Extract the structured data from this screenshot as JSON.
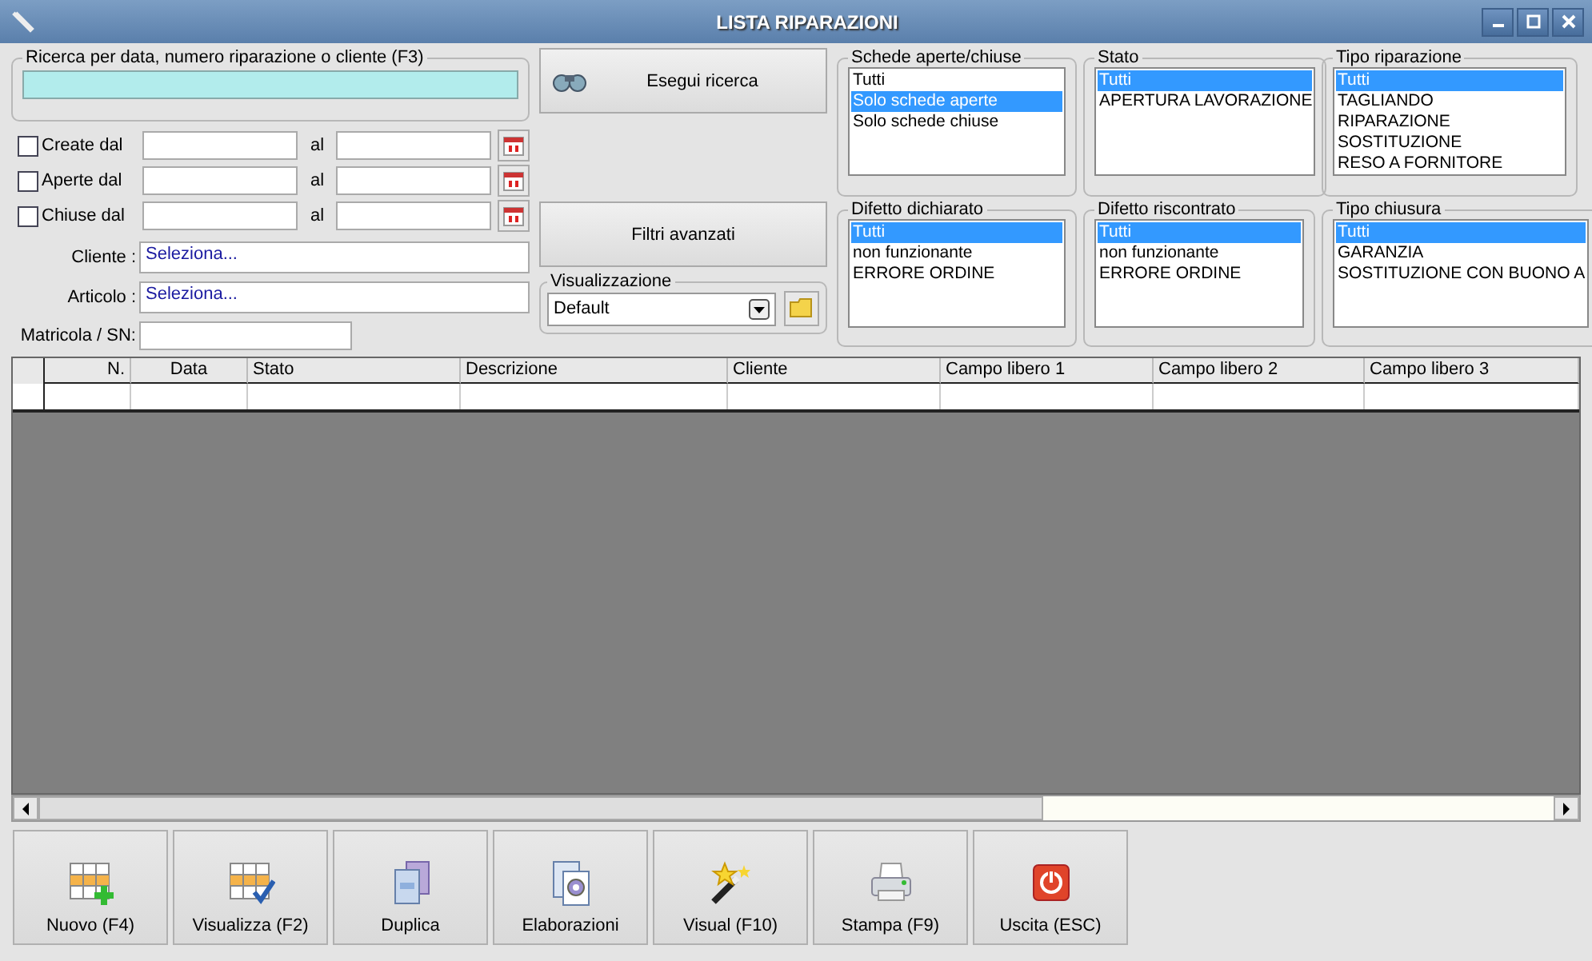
{
  "window": {
    "title": "LISTA RIPARAZIONI"
  },
  "search": {
    "label": "Ricerca per data, numero riparazione o cliente (F3)"
  },
  "date_filters": [
    {
      "label": "Create dal",
      "checked": false,
      "to_label": "al"
    },
    {
      "label": "Aperte dal",
      "checked": false,
      "to_label": "al"
    },
    {
      "label": "Chiuse dal",
      "checked": false,
      "to_label": "al"
    }
  ],
  "pickers": [
    {
      "label": "Cliente :",
      "value": "Seleziona..."
    },
    {
      "label": "Articolo :",
      "value": "Seleziona..."
    }
  ],
  "serial": {
    "label": "Matricola / SN:"
  },
  "search_button": "Esegui ricerca",
  "advanced_button": "Filtri avanzati",
  "view": {
    "label": "Visualizzazione",
    "value": "Default"
  },
  "filters": [
    {
      "title": "Schede aperte/chiuse",
      "items": [
        {
          "label": "Tutti",
          "selected": false
        },
        {
          "label": "Solo schede aperte",
          "selected": true
        },
        {
          "label": "Solo schede chiuse",
          "selected": false
        }
      ]
    },
    {
      "title": "Stato",
      "items": [
        {
          "label": "Tutti",
          "selected": true
        },
        {
          "label": "APERTURA LAVORAZIONE",
          "selected": false
        }
      ]
    },
    {
      "title": "Tipo riparazione",
      "items": [
        {
          "label": "Tutti",
          "selected": true
        },
        {
          "label": "TAGLIANDO",
          "selected": false
        },
        {
          "label": "RIPARAZIONE",
          "selected": false
        },
        {
          "label": "SOSTITUZIONE",
          "selected": false
        },
        {
          "label": "RESO A FORNITORE",
          "selected": false
        }
      ]
    },
    {
      "title": "Difetto dichiarato",
      "items": [
        {
          "label": "Tutti",
          "selected": true
        },
        {
          "label": "non funzionante",
          "selected": false
        },
        {
          "label": "ERRORE ORDINE",
          "selected": false
        }
      ]
    },
    {
      "title": "Difetto riscontrato",
      "items": [
        {
          "label": "Tutti",
          "selected": true
        },
        {
          "label": "non funzionante",
          "selected": false
        },
        {
          "label": "ERRORE ORDINE",
          "selected": false
        }
      ]
    },
    {
      "title": "Tipo chiusura",
      "items": [
        {
          "label": "Tutti",
          "selected": true
        },
        {
          "label": "GARANZIA",
          "selected": false
        },
        {
          "label": "SOSTITUZIONE CON BUONO A",
          "selected": false
        }
      ]
    }
  ],
  "table": {
    "columns": [
      "N.",
      "Data",
      "Stato",
      "Descrizione",
      "Cliente",
      "Campo libero 1",
      "Campo libero 2",
      "Campo libero 3"
    ]
  },
  "actions": [
    {
      "label": "Nuovo (F4)",
      "kind": "new"
    },
    {
      "label": "Visualizza (F2)",
      "kind": "view"
    },
    {
      "label": "Duplica",
      "kind": "duplicate"
    },
    {
      "label": "Elaborazioni",
      "kind": "process"
    },
    {
      "label": "Visual (F10)",
      "kind": "wand"
    },
    {
      "label": "Stampa (F9)",
      "kind": "print"
    },
    {
      "label": "Uscita (ESC)",
      "kind": "exit"
    }
  ]
}
